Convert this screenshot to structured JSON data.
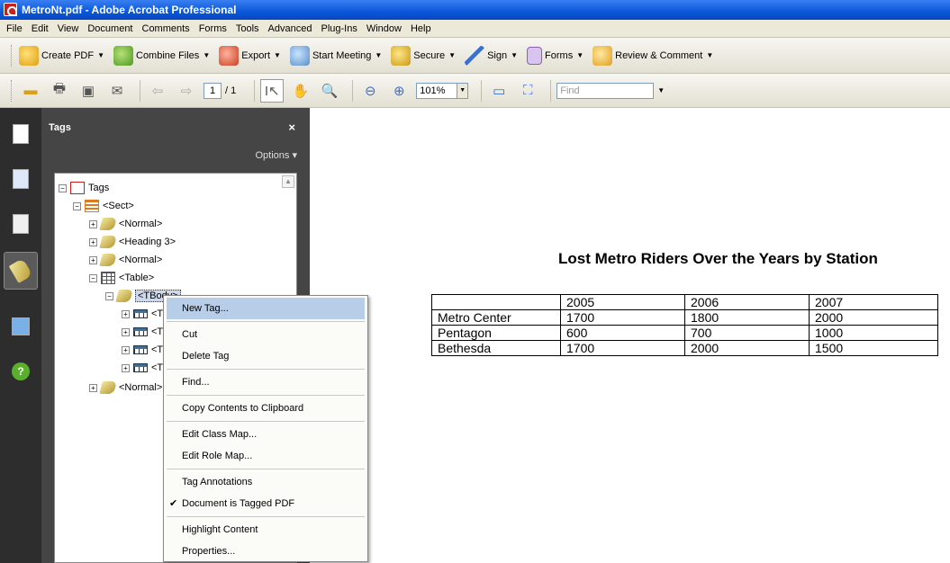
{
  "window": {
    "title": "MetroNt.pdf - Adobe Acrobat Professional"
  },
  "menubar": [
    "File",
    "Edit",
    "View",
    "Document",
    "Comments",
    "Forms",
    "Tools",
    "Advanced",
    "Plug-Ins",
    "Window",
    "Help"
  ],
  "toolbar1": {
    "create_pdf": "Create PDF",
    "combine_files": "Combine Files",
    "export": "Export",
    "start_meeting": "Start Meeting",
    "secure": "Secure",
    "sign": "Sign",
    "forms": "Forms",
    "review": "Review & Comment"
  },
  "toolbar2": {
    "page_current": "1",
    "page_total": "/ 1",
    "zoom": "101%",
    "find_placeholder": "Find"
  },
  "tags_panel": {
    "title": "Tags",
    "close": "×",
    "options": "Options ▾",
    "tree": {
      "root": "Tags",
      "sect": "<Sect>",
      "normal1": "<Normal>",
      "heading3": "<Heading 3>",
      "normal2": "<Normal>",
      "table": "<Table>",
      "tbody": "<TBody>",
      "tr1": "<T",
      "tr2": "<T",
      "tr3": "<T",
      "tr4": "<T",
      "normal3": "<Normal>"
    }
  },
  "context_menu": {
    "new_tag": "New Tag...",
    "cut": "Cut",
    "delete_tag": "Delete Tag",
    "find": "Find...",
    "copy_contents": "Copy Contents to Clipboard",
    "edit_class_map": "Edit Class Map...",
    "edit_role_map": "Edit Role Map...",
    "tag_annotations": "Tag Annotations",
    "doc_tagged": "Document is Tagged PDF",
    "highlight_content": "Highlight Content",
    "properties": "Properties..."
  },
  "document": {
    "title": "Lost Metro Riders Over the Years by Station",
    "table": {
      "header": [
        "",
        "2005",
        "2006",
        "2007"
      ],
      "rows": [
        [
          "Metro Center",
          "1700",
          "1800",
          "2000"
        ],
        [
          "Pentagon",
          "600",
          "700",
          "1000"
        ],
        [
          "Bethesda",
          "1700",
          "2000",
          "1500"
        ]
      ]
    }
  }
}
